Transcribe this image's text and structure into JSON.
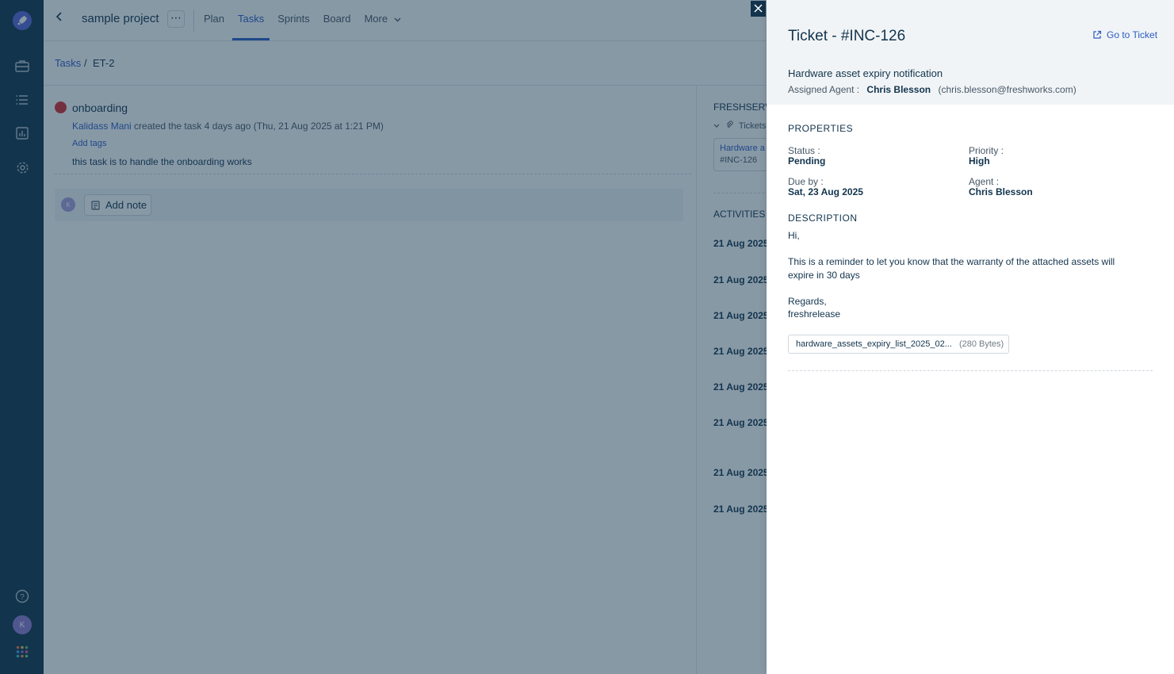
{
  "header": {
    "project": "sample project",
    "more_dots": "⋯",
    "tabs": [
      "Plan",
      "Tasks",
      "Sprints",
      "Board",
      "More"
    ]
  },
  "breadcrumb": {
    "parent": "Tasks",
    "separator": "/",
    "current": "ET-2"
  },
  "task": {
    "title": "onboarding",
    "creator": "Kalidass Mani",
    "created_text": "created the task 4 days ago (Thu, 21 Aug 2025 at 1:21 PM)",
    "add_tags": "Add tags",
    "description": "this task is to handle the onboarding works",
    "note_avatar": "K",
    "add_note": "Add note"
  },
  "side_pane": {
    "heading": "FRESHSERV",
    "tickets_label": "Tickets",
    "card_title": "Hardware a",
    "card_id": "#INC-126",
    "activities": "ACTIVITIES",
    "activity_dates": [
      "21 Aug 2025",
      "21 Aug 2025",
      "21 Aug 2025",
      "21 Aug 2025",
      "21 Aug 2025",
      "21 Aug 2025",
      "21 Aug 2025",
      "21 Aug 2025"
    ]
  },
  "rail": {
    "avatar": "K"
  },
  "drawer": {
    "title": "Ticket - #INC-126",
    "go_to": "Go to Ticket",
    "subject": "Hardware asset expiry notification",
    "assigned_label": "Assigned Agent :",
    "assigned_name": "Chris Blesson",
    "assigned_email": "(chris.blesson@freshworks.com)",
    "properties_heading": "PROPERTIES",
    "status_label": "Status :",
    "status_value": "Pending",
    "priority_label": "Priority :",
    "priority_value": "High",
    "due_label": "Due by :",
    "due_value": "Sat, 23 Aug 2025",
    "agent_label": "Agent :",
    "agent_value": "Chris Blesson",
    "description_heading": "DESCRIPTION",
    "desc_hi": "Hi,",
    "desc_line1": "This is a reminder to let you know that the warranty of the attached assets will",
    "desc_line2": "expire in 30 days",
    "desc_regards": "Regards,",
    "desc_sign": "freshrelease",
    "attachment_name": "hardware_assets_expiry_list_2025_02...",
    "attachment_size": "(280 Bytes)"
  },
  "colors": {
    "accent": "#2c5cc5",
    "rail": "#12344d",
    "bug": "#d72d30"
  }
}
